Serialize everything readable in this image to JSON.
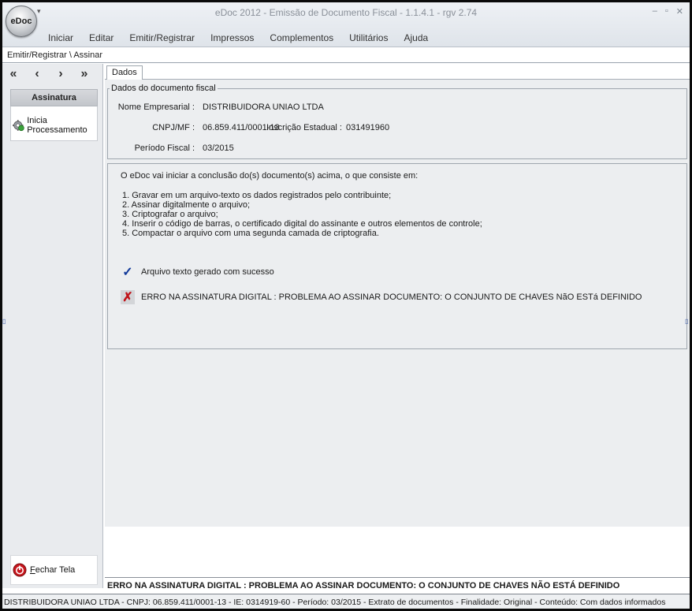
{
  "app": {
    "logo": "eDoc",
    "title": "eDoc 2012 - Emissão de Documento Fiscal - 1.1.4.1 - rgv 2.74",
    "window_controls": [
      "–",
      "▫",
      "✕"
    ]
  },
  "menu": [
    "Iniciar",
    "Editar",
    "Emitir/Registrar",
    "Impressos",
    "Complementos",
    "Utilitários",
    "Ajuda"
  ],
  "breadcrumb": "Emitir/Registrar \\ Assinar",
  "nav": {
    "first": "«",
    "prev": "‹",
    "next": "›",
    "last": "»"
  },
  "sidebar": {
    "section_title": "Assinatura",
    "action_label": "Inicia Processamento",
    "close_label_first": "F",
    "close_label_rest": "echar Tela"
  },
  "tab": "Dados",
  "doc": {
    "legend": "Dados do documento fiscal",
    "nome_label": "Nome Empresarial :",
    "nome_value": "DISTRIBUIDORA UNIAO LTDA",
    "cnpj_label": "CNPJ/MF :",
    "cnpj_value": "06.859.411/0001-13",
    "ie_label": "Inscrição Estadual :",
    "ie_value": "031491960",
    "periodo_label": "Período Fiscal :",
    "periodo_value": "03/2015"
  },
  "info": {
    "intro": "O eDoc vai iniciar a conclusão do(s) documento(s) acima, o que consiste em:",
    "steps": [
      "1. Gravar em um arquivo-texto os dados registrados pelo contribuinte;",
      "2. Assinar digitalmente o arquivo;",
      "3. Criptografar o arquivo;",
      "4. Inserir o código de barras, o certificado digital do assinante e outros elementos de controle;",
      "5. Compactar o arquivo com uma segunda camada de criptografia."
    ],
    "success_msg": "Arquivo texto gerado com sucesso",
    "error_msg": "ERRO NA ASSINATURA DIGITAL : PROBLEMA AO ASSINAR DOCUMENTO:   O CONJUNTO DE CHAVES NãO ESTá DEFINIDO"
  },
  "error_bar": "ERRO NA ASSINATURA DIGITAL : PROBLEMA AO ASSINAR DOCUMENTO:   O CONJUNTO DE CHAVES NÃO ESTÁ DEFINIDO",
  "status_bar": "DISTRIBUIDORA UNIAO LTDA - CNPJ: 06.859.411/0001-13 - IE: 0314919-60 - Período: 03/2015 - Extrato de documentos - Finalidade: Original - Conteúdo: Com dados informados"
}
